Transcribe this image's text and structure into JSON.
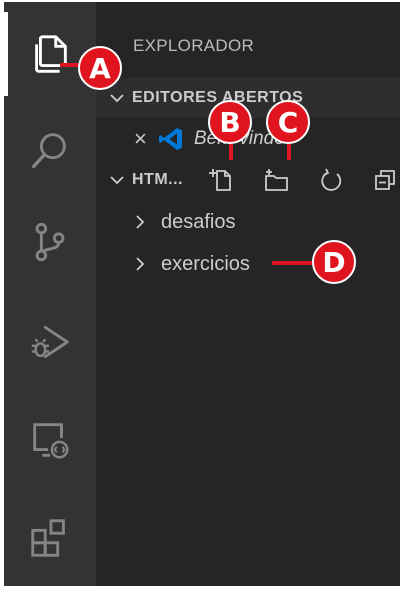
{
  "activity_bar": [
    {
      "name": "explorer-icon",
      "active": true
    },
    {
      "name": "search-icon",
      "active": false
    },
    {
      "name": "source-control-icon",
      "active": false
    },
    {
      "name": "run-debug-icon",
      "active": false
    },
    {
      "name": "remote-explorer-icon",
      "active": false
    },
    {
      "name": "extensions-icon",
      "active": false
    }
  ],
  "sidebar": {
    "title": "EXPLORADOR",
    "open_editors": {
      "label": "EDITORES ABERTOS",
      "items": [
        {
          "name": "Bem-vindo",
          "icon": "vscode-logo-icon",
          "close_symbol": "×"
        }
      ]
    },
    "folder": {
      "label": "HTM...",
      "actions": [
        "new-file-icon",
        "new-folder-icon",
        "refresh-icon",
        "collapse-all-icon"
      ],
      "tree": [
        {
          "label": "desafios"
        },
        {
          "label": "exercicios"
        }
      ]
    }
  },
  "annotations": {
    "a": "A",
    "b": "B",
    "c": "C",
    "d": "D"
  },
  "colors": {
    "activity_bar": "#333333",
    "sidebar": "#252526",
    "icon_inactive": "#858585",
    "text": "#cccccc",
    "accent_blue": "#0078d7",
    "callout_red": "#e0141e"
  }
}
